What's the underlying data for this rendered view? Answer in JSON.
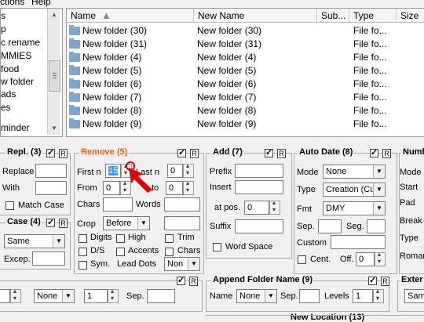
{
  "menubar": {
    "items": [
      "ctions",
      "Help"
    ]
  },
  "tree": {
    "items": [
      "s",
      "p",
      "c rename",
      "MMIES",
      "food",
      "w folder",
      "ads",
      "es",
      "",
      "minder"
    ]
  },
  "file_list": {
    "columns": [
      "Name",
      "New Name",
      "Sub...",
      "Type",
      "Size"
    ],
    "rows": [
      {
        "name": "New folder (30)",
        "new_name": "New folder (30)",
        "type": "File fo..."
      },
      {
        "name": "New folder (31)",
        "new_name": "New folder (31)",
        "type": "File fo..."
      },
      {
        "name": "New folder (4)",
        "new_name": "New folder (4)",
        "type": "File fo..."
      },
      {
        "name": "New folder (5)",
        "new_name": "New folder (5)",
        "type": "File fo..."
      },
      {
        "name": "New folder (6)",
        "new_name": "New folder (6)",
        "type": "File fo..."
      },
      {
        "name": "New folder (7)",
        "new_name": "New folder (7)",
        "type": "File fo..."
      },
      {
        "name": "New folder (8)",
        "new_name": "New folder (8)",
        "type": "File fo..."
      },
      {
        "name": "New folder (9)",
        "new_name": "New folder (9)",
        "type": "File fo..."
      }
    ]
  },
  "repl": {
    "title": "Repl. (3)",
    "replace_label": "Replace",
    "with_label": "With",
    "match_case_label": "Match Case",
    "r_label": "R"
  },
  "case": {
    "title": "Case (4)",
    "mode_value": "Same",
    "excep_label": "Excep.",
    "r_label": "R"
  },
  "remove": {
    "title": "Remove (5)",
    "first_n_label": "First n",
    "first_n_value": "15",
    "last_n_label": "Last n",
    "last_n_value": "0",
    "from_label": "From",
    "from_value": "0",
    "to_label": "to",
    "to_value": "0",
    "chars_label": "Chars",
    "words_label": "Words",
    "crop_label": "Crop",
    "crop_value": "Before",
    "digits_label": "Digits",
    "high_label": "High",
    "trim_label": "Trim",
    "ds_label": "D/S",
    "accents_label": "Accents",
    "chars2_label": "Chars",
    "sym_label": "Sym.",
    "lead_dots_label": "Lead Dots",
    "lead_dots_value": "Non",
    "r_label": "R"
  },
  "add": {
    "title": "Add (7)",
    "prefix_label": "Prefix",
    "insert_label": "Insert",
    "at_pos_label": "at pos.",
    "at_pos_value": "0",
    "suffix_label": "Suffix",
    "word_space_label": "Word Space",
    "r_label": "R"
  },
  "auto_date": {
    "title": "Auto Date (8)",
    "mode_label": "Mode",
    "mode_value": "None",
    "type_label": "Type",
    "type_value": "Creation (Cur",
    "fmt_label": "Fmt",
    "fmt_value": "DMY",
    "sep_label": "Sep.",
    "seg_label": "Seg.",
    "custom_label": "Custom",
    "cent_label": "Cent.",
    "off_label": "Off.",
    "off_value": "0",
    "r_label": "R"
  },
  "numbering": {
    "title": "Numb",
    "mode_label": "Mode",
    "start_label": "Start",
    "pad_label": "Pad",
    "break_label": "Break",
    "type_label": "Type",
    "roman_label": "Roman"
  },
  "bottom_left": {
    "none_value": "None",
    "num_value": "1",
    "sep_label": "Sep.",
    "r_label": "R"
  },
  "append_folder": {
    "title": "Append Folder Name (9)",
    "name_label": "Name",
    "name_value": "None",
    "sep_label": "Sep.",
    "levels_label": "Levels",
    "levels_value": "1",
    "r_label": "R"
  },
  "extension": {
    "title": "Exter",
    "value": "Sam"
  },
  "new_location": {
    "title": "New Location (13)"
  },
  "colors": {
    "remove_title": "#e8601c",
    "annotation": "#e00000",
    "selection": "#3399ff"
  }
}
